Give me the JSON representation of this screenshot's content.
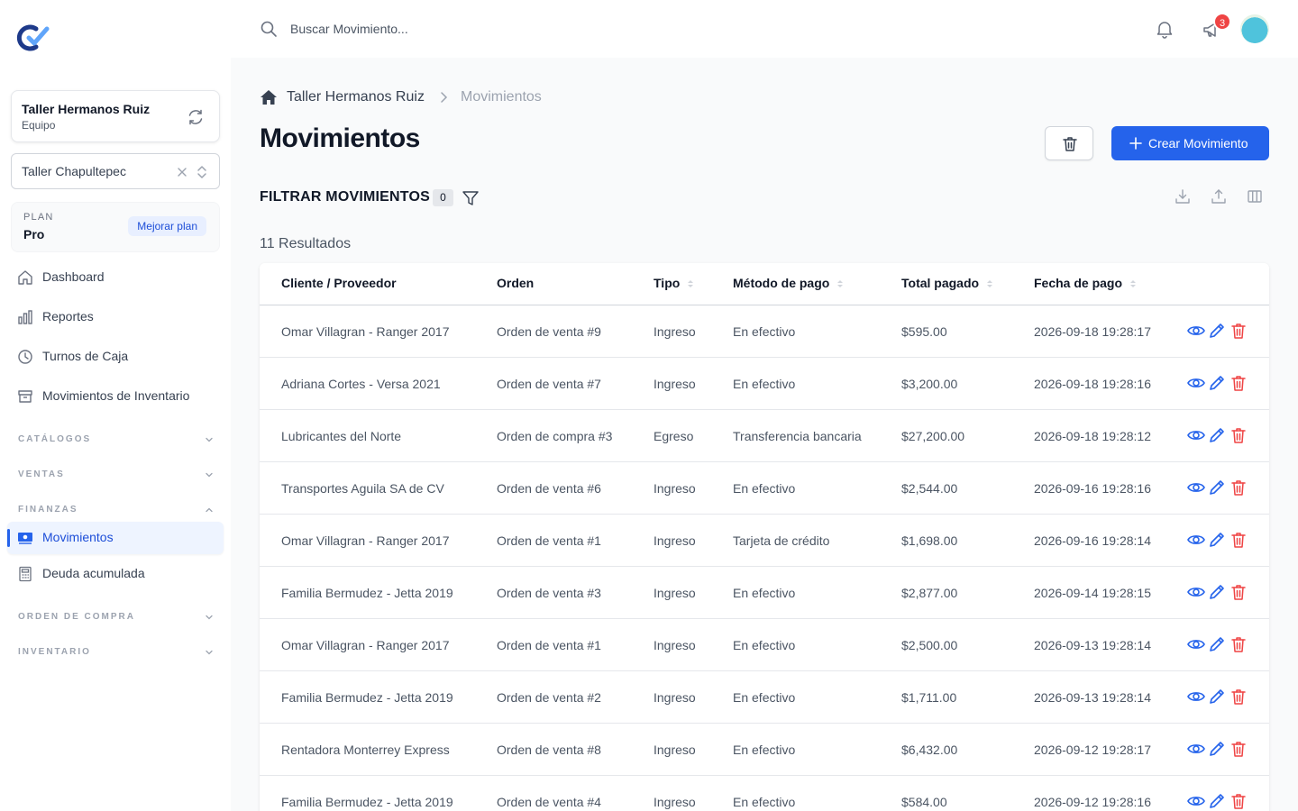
{
  "sidebar": {
    "team": {
      "name": "Taller Hermanos Ruiz",
      "subtitle": "Equipo"
    },
    "branch": {
      "value": "Taller Chapultepec"
    },
    "plan": {
      "label": "PLAN",
      "value": "Pro",
      "upgrade_label": "Mejorar plan"
    },
    "nav": [
      {
        "label": "Dashboard",
        "icon": "home-icon"
      },
      {
        "label": "Reportes",
        "icon": "bar-chart-icon"
      },
      {
        "label": "Turnos de Caja",
        "icon": "clock-icon"
      },
      {
        "label": "Movimientos de Inventario",
        "icon": "archive-icon"
      }
    ],
    "sections": [
      {
        "label": "CATÁLOGOS",
        "expanded": false
      },
      {
        "label": "VENTAS",
        "expanded": false
      },
      {
        "label": "FINANZAS",
        "expanded": true
      },
      {
        "label": "ORDEN DE COMPRA",
        "expanded": false
      },
      {
        "label": "INVENTARIO",
        "expanded": false
      }
    ],
    "finanzas_items": [
      {
        "label": "Movimientos",
        "icon": "cash-icon",
        "active": true
      },
      {
        "label": "Deuda acumulada",
        "icon": "calculator-icon",
        "active": false
      }
    ]
  },
  "topbar": {
    "search_placeholder": "Buscar Movimiento...",
    "notification_badge": "3"
  },
  "breadcrumb": {
    "team": "Taller Hermanos Ruiz",
    "current": "Movimientos"
  },
  "page": {
    "title": "Movimientos",
    "create_label": "Crear Movimiento",
    "filter_title": "FILTRAR MOVIMIENTOS",
    "filter_count": "0",
    "results": "11 Resultados"
  },
  "table": {
    "headers": [
      "Cliente / Proveedor",
      "Orden",
      "Tipo",
      "Método de pago",
      "Total pagado",
      "Fecha de pago"
    ],
    "rows": [
      [
        "Omar Villagran - Ranger 2017",
        "Orden de venta #9",
        "Ingreso",
        "En efectivo",
        "$595.00",
        "2026-09-18 19:28:17"
      ],
      [
        "Adriana Cortes - Versa 2021",
        "Orden de venta #7",
        "Ingreso",
        "En efectivo",
        "$3,200.00",
        "2026-09-18 19:28:16"
      ],
      [
        "Lubricantes del Norte",
        "Orden de compra #3",
        "Egreso",
        "Transferencia bancaria",
        "$27,200.00",
        "2026-09-18 19:28:12"
      ],
      [
        "Transportes Aguila SA de CV",
        "Orden de venta #6",
        "Ingreso",
        "En efectivo",
        "$2,544.00",
        "2026-09-16 19:28:16"
      ],
      [
        "Omar Villagran - Ranger 2017",
        "Orden de venta #1",
        "Ingreso",
        "Tarjeta de crédito",
        "$1,698.00",
        "2026-09-16 19:28:14"
      ],
      [
        "Familia Bermudez - Jetta 2019",
        "Orden de venta #3",
        "Ingreso",
        "En efectivo",
        "$2,877.00",
        "2026-09-14 19:28:15"
      ],
      [
        "Omar Villagran - Ranger 2017",
        "Orden de venta #1",
        "Ingreso",
        "En efectivo",
        "$2,500.00",
        "2026-09-13 19:28:14"
      ],
      [
        "Familia Bermudez - Jetta 2019",
        "Orden de venta #2",
        "Ingreso",
        "En efectivo",
        "$1,711.00",
        "2026-09-13 19:28:14"
      ],
      [
        "Rentadora Monterrey Express",
        "Orden de venta #8",
        "Ingreso",
        "En efectivo",
        "$6,432.00",
        "2026-09-12 19:28:17"
      ],
      [
        "Familia Bermudez - Jetta 2019",
        "Orden de venta #4",
        "Ingreso",
        "En efectivo",
        "$584.00",
        "2026-09-12 19:28:16"
      ]
    ]
  },
  "colors": {
    "primary": "#2563eb",
    "danger": "#ef4444",
    "sidebar_bg": "#ffffff",
    "content_bg": "#f9fafb"
  }
}
